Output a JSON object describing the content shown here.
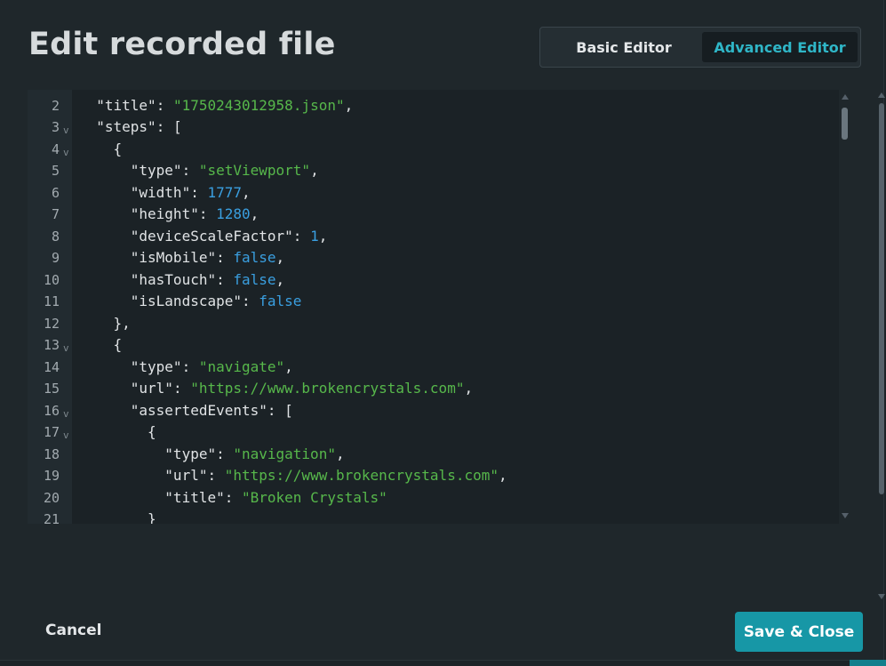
{
  "dialog": {
    "title": "Edit recorded file",
    "tabs": [
      {
        "label": "Basic Editor",
        "active": false
      },
      {
        "label": "Advanced Editor",
        "active": true
      }
    ],
    "cancel_label": "Cancel",
    "save_label": "Save & Close"
  },
  "colors": {
    "accent": "#1797a6",
    "active_tab_text": "#2fb6c7",
    "string": "#57b84b",
    "number": "#3a9fe0"
  },
  "editor": {
    "lines": [
      {
        "n": "2",
        "fold": false,
        "indent": 2,
        "tokens": [
          [
            "k",
            "\"title\""
          ],
          [
            "p",
            ": "
          ],
          [
            "s",
            "\"1750243012958.json\""
          ],
          [
            "p",
            ","
          ]
        ]
      },
      {
        "n": "3",
        "fold": true,
        "indent": 2,
        "tokens": [
          [
            "k",
            "\"steps\""
          ],
          [
            "p",
            ": ["
          ]
        ]
      },
      {
        "n": "4",
        "fold": true,
        "indent": 4,
        "tokens": [
          [
            "p",
            "{"
          ]
        ]
      },
      {
        "n": "5",
        "fold": false,
        "indent": 6,
        "tokens": [
          [
            "k",
            "\"type\""
          ],
          [
            "p",
            ": "
          ],
          [
            "s",
            "\"setViewport\""
          ],
          [
            "p",
            ","
          ]
        ]
      },
      {
        "n": "6",
        "fold": false,
        "indent": 6,
        "tokens": [
          [
            "k",
            "\"width\""
          ],
          [
            "p",
            ": "
          ],
          [
            "n",
            "1777"
          ],
          [
            "p",
            ","
          ]
        ]
      },
      {
        "n": "7",
        "fold": false,
        "indent": 6,
        "tokens": [
          [
            "k",
            "\"height\""
          ],
          [
            "p",
            ": "
          ],
          [
            "n",
            "1280"
          ],
          [
            "p",
            ","
          ]
        ]
      },
      {
        "n": "8",
        "fold": false,
        "indent": 6,
        "tokens": [
          [
            "k",
            "\"deviceScaleFactor\""
          ],
          [
            "p",
            ": "
          ],
          [
            "n",
            "1"
          ],
          [
            "p",
            ","
          ]
        ]
      },
      {
        "n": "9",
        "fold": false,
        "indent": 6,
        "tokens": [
          [
            "k",
            "\"isMobile\""
          ],
          [
            "p",
            ": "
          ],
          [
            "b",
            "false"
          ],
          [
            "p",
            ","
          ]
        ]
      },
      {
        "n": "10",
        "fold": false,
        "indent": 6,
        "tokens": [
          [
            "k",
            "\"hasTouch\""
          ],
          [
            "p",
            ": "
          ],
          [
            "b",
            "false"
          ],
          [
            "p",
            ","
          ]
        ]
      },
      {
        "n": "11",
        "fold": false,
        "indent": 6,
        "tokens": [
          [
            "k",
            "\"isLandscape\""
          ],
          [
            "p",
            ": "
          ],
          [
            "b",
            "false"
          ]
        ]
      },
      {
        "n": "12",
        "fold": false,
        "indent": 4,
        "tokens": [
          [
            "p",
            "},"
          ]
        ]
      },
      {
        "n": "13",
        "fold": true,
        "indent": 4,
        "tokens": [
          [
            "p",
            "{"
          ]
        ]
      },
      {
        "n": "14",
        "fold": false,
        "indent": 6,
        "tokens": [
          [
            "k",
            "\"type\""
          ],
          [
            "p",
            ": "
          ],
          [
            "s",
            "\"navigate\""
          ],
          [
            "p",
            ","
          ]
        ]
      },
      {
        "n": "15",
        "fold": false,
        "indent": 6,
        "tokens": [
          [
            "k",
            "\"url\""
          ],
          [
            "p",
            ": "
          ],
          [
            "s",
            "\"https://www.brokencrystals.com\""
          ],
          [
            "p",
            ","
          ]
        ]
      },
      {
        "n": "16",
        "fold": true,
        "indent": 6,
        "tokens": [
          [
            "k",
            "\"assertedEvents\""
          ],
          [
            "p",
            ": ["
          ]
        ]
      },
      {
        "n": "17",
        "fold": true,
        "indent": 8,
        "tokens": [
          [
            "p",
            "{"
          ]
        ]
      },
      {
        "n": "18",
        "fold": false,
        "indent": 10,
        "tokens": [
          [
            "k",
            "\"type\""
          ],
          [
            "p",
            ": "
          ],
          [
            "s",
            "\"navigation\""
          ],
          [
            "p",
            ","
          ]
        ]
      },
      {
        "n": "19",
        "fold": false,
        "indent": 10,
        "tokens": [
          [
            "k",
            "\"url\""
          ],
          [
            "p",
            ": "
          ],
          [
            "s",
            "\"https://www.brokencrystals.com\""
          ],
          [
            "p",
            ","
          ]
        ]
      },
      {
        "n": "20",
        "fold": false,
        "indent": 10,
        "tokens": [
          [
            "k",
            "\"title\""
          ],
          [
            "p",
            ": "
          ],
          [
            "s",
            "\"Broken Crystals\""
          ]
        ]
      },
      {
        "n": "21",
        "fold": false,
        "indent": 8,
        "tokens": [
          [
            "p",
            "}"
          ]
        ]
      }
    ]
  }
}
